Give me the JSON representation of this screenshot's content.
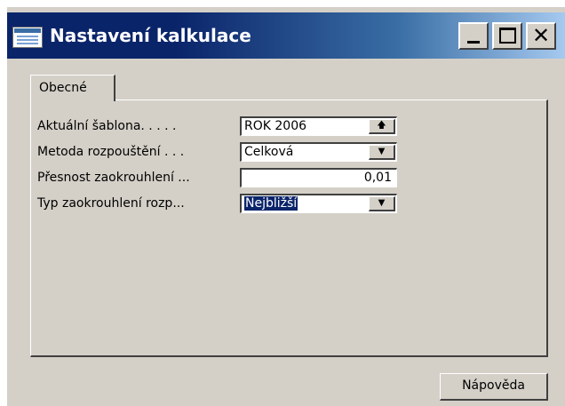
{
  "window": {
    "title": "Nastavení kalkulace"
  },
  "caption_buttons": {
    "minimize": "minimize-icon",
    "maximize": "maximize-icon",
    "close": "close-icon"
  },
  "tabs": [
    {
      "label": "Obecné",
      "active": true
    }
  ],
  "fields": [
    {
      "label": "Aktuální šablona. . . . .",
      "value": "ROK 2006",
      "control": "lookup",
      "button_icon": "up-arrow-icon"
    },
    {
      "label": "Metoda rozpouštění . . .",
      "value": "Celková",
      "control": "dropdown",
      "button_icon": "dropdown-arrow-icon"
    },
    {
      "label": "Přesnost zaokrouhlení ...",
      "value": "0,01",
      "control": "text"
    },
    {
      "label": "Typ zaokrouhlení rozp...",
      "value": "Nejbližší",
      "control": "dropdown",
      "button_icon": "dropdown-arrow-icon",
      "selected": true
    }
  ],
  "footer": {
    "help_label": "Nápověda"
  },
  "colors": {
    "title_bar_start": "#0a246a",
    "title_bar_end": "#a6caf0",
    "face": "#d4d0c8",
    "selection": "#0a246a"
  }
}
